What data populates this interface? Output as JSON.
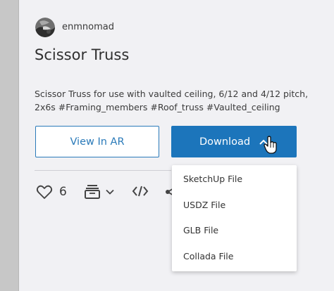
{
  "author": {
    "name": "enmnomad",
    "avatar_icon": "avatar-photo"
  },
  "model": {
    "title": "Scissor Truss",
    "description": "Scissor Truss for use with vaulted ceiling, 6/12 and 4/12 pitch, 2x6s #Framing_members #Roof_truss #Vaulted_ceiling"
  },
  "buttons": {
    "view_ar": "View In AR",
    "download": "Download"
  },
  "actions": {
    "like_count": "6",
    "icons": [
      "heart-icon",
      "collection-icon",
      "chevron-down-icon",
      "embed-code-icon",
      "share-icon"
    ]
  },
  "download_menu": {
    "items": [
      "SketchUp File",
      "USDZ File",
      "GLB File",
      "Collada File"
    ]
  },
  "colors": {
    "accent": "#1c75bb",
    "outline_button": "#2a7ab9",
    "background": "#f1f1f4",
    "rail": "#c7c7c7"
  }
}
